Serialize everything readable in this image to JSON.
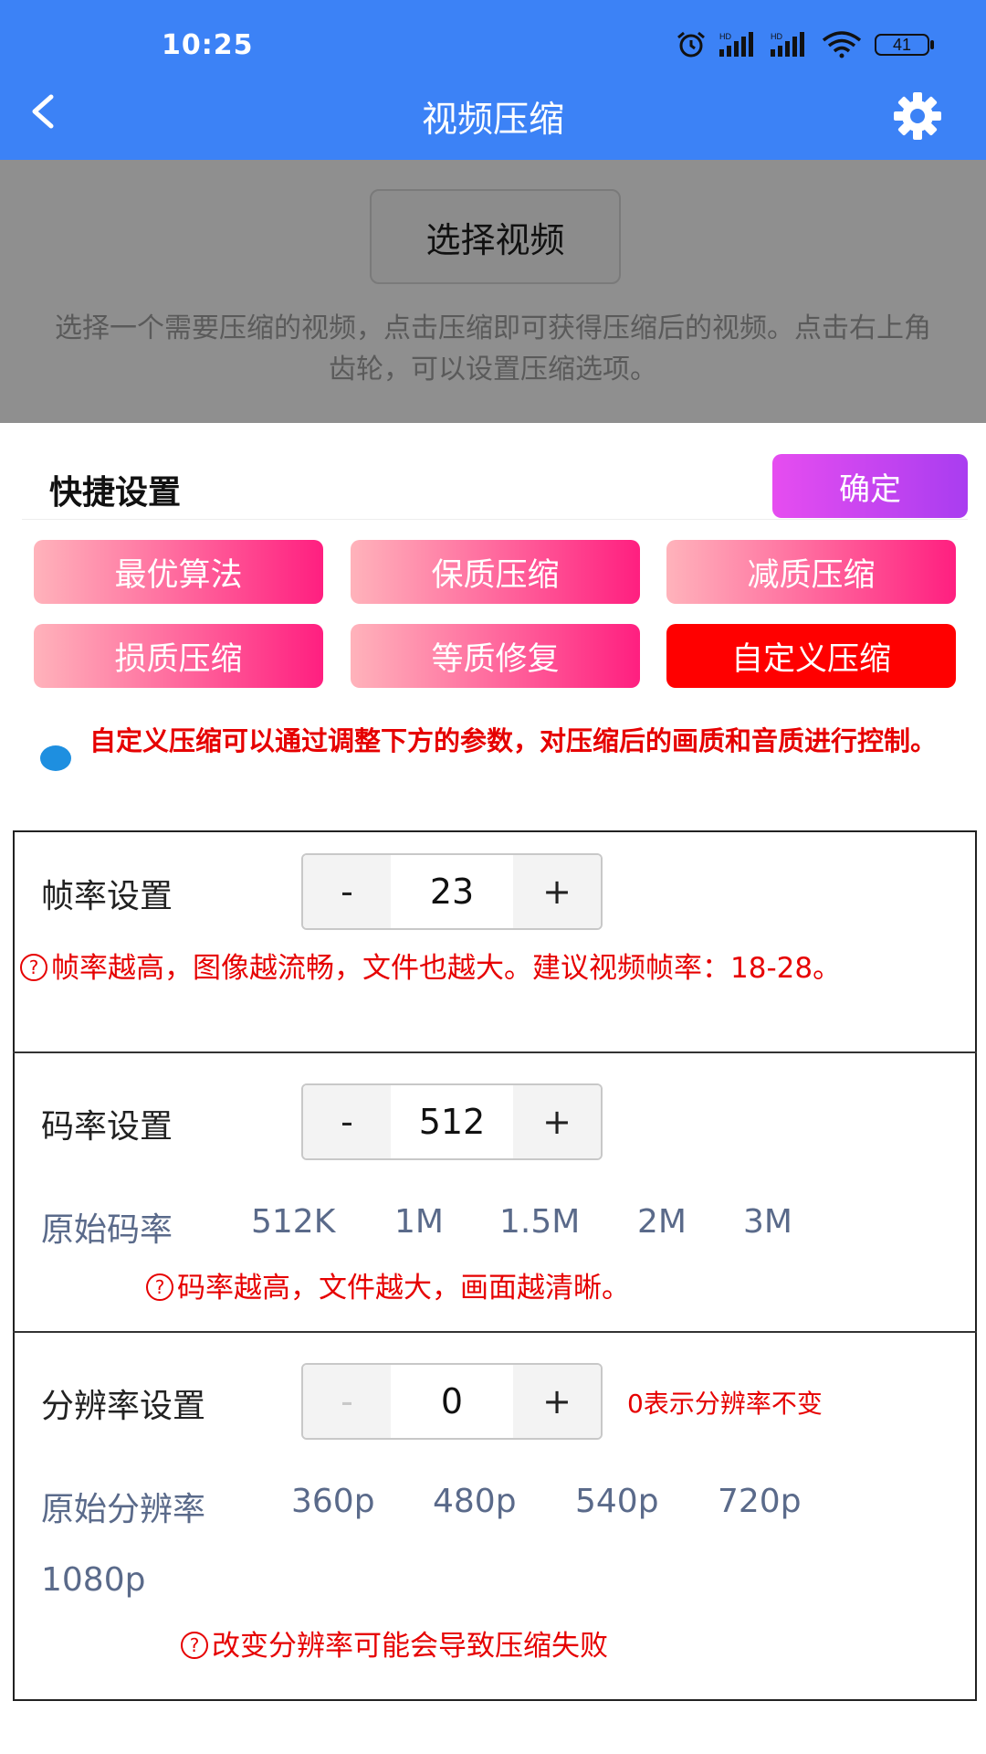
{
  "status_bar": {
    "time": "10:25",
    "battery": "41",
    "hd1": "HD",
    "hd2": "HD"
  },
  "header": {
    "title": "视频压缩",
    "back_icon": "chevron-left-icon",
    "settings_icon": "gear-icon",
    "background_color": "#3c82f6"
  },
  "select_area": {
    "button_label": "选择视频",
    "description": "选择一个需要压缩的视频，点击压缩即可获得压缩后的视频。点击右上角齿轮，可以设置压缩选项。"
  },
  "quick_settings": {
    "title": "快捷设置",
    "confirm_label": "确定",
    "presets": [
      {
        "label": "最优算法",
        "active": false
      },
      {
        "label": "保质压缩",
        "active": false
      },
      {
        "label": "减质压缩",
        "active": false
      },
      {
        "label": "损质压缩",
        "active": false
      },
      {
        "label": "等质修复",
        "active": false
      },
      {
        "label": "自定义压缩",
        "active": true
      }
    ],
    "info_text": "自定义压缩可以通过调整下方的参数，对压缩后的画质和音质进行控制。"
  },
  "frame_rate": {
    "label": "帧率设置",
    "minus": "-",
    "value": "23",
    "plus": "+",
    "tip": "帧率越高，图像越流畅，文件也越大。建议视频帧率：18-28。"
  },
  "bit_rate": {
    "label": "码率设置",
    "minus": "-",
    "value": "512",
    "plus": "+",
    "options": [
      "原始码率",
      "512K",
      "1M",
      "1.5M",
      "2M",
      "3M"
    ],
    "tip": "码率越高，文件越大，画面越清晰。"
  },
  "resolution": {
    "label": "分辨率设置",
    "minus": "-",
    "value": "0",
    "plus": "+",
    "note": "0表示分辨率不变",
    "options": [
      "原始分辨率",
      "360p",
      "480p",
      "540p",
      "720p",
      "1080p"
    ],
    "tip": "改变分辨率可能会导致压缩失败"
  },
  "tip_icon_glyph": "?"
}
